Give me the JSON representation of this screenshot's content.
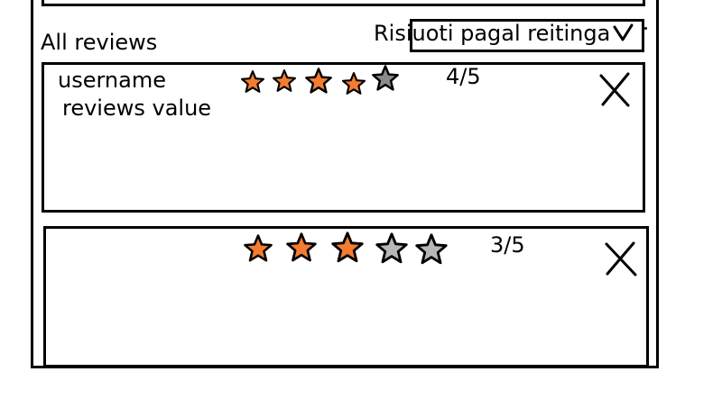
{
  "header": {
    "heading": "All reviews"
  },
  "sort": {
    "label": "Risiuoti pagal reitinga",
    "chevron_icon": "chevron-down-icon"
  },
  "reviews": [
    {
      "username": "username",
      "text": "reviews value",
      "rating": 4,
      "max_rating": 5,
      "score_label": "4/5",
      "delete_icon": "close-icon"
    },
    {
      "username": "",
      "text": "",
      "rating": 3,
      "max_rating": 5,
      "score_label": "3/5",
      "delete_icon": "close-icon"
    }
  ],
  "colors": {
    "star_filled": "#f47c32",
    "star_empty": "#b7b7b7",
    "star_empty_dark": "#8a8a8a",
    "outline": "#000000"
  }
}
